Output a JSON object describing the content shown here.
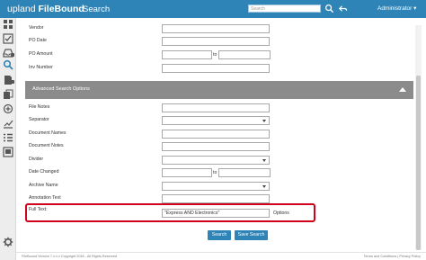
{
  "header": {
    "brand_prefix": "upland",
    "brand_name": "FileBound",
    "page_title": "Search",
    "search_placeholder": "Search",
    "user_label": "Administrator",
    "accent_color": "#2e84b6"
  },
  "fields_basic": [
    {
      "label": "Vendor"
    },
    {
      "label": "PO Date"
    },
    {
      "label": "PO Amount"
    },
    {
      "label": "Inv Number"
    }
  ],
  "range_to": "to",
  "advanced": {
    "title": "Advanced Search Options",
    "fields": [
      {
        "label": "File Notes"
      },
      {
        "label": "Separator"
      },
      {
        "label": "Document Names"
      },
      {
        "label": "Document Notes"
      },
      {
        "label": "Divider"
      },
      {
        "label": "Date Changed"
      },
      {
        "label": "Archive Name"
      },
      {
        "label": "Annotation Text"
      }
    ]
  },
  "fulltext": {
    "label": "Full Text:",
    "value": "\"Express AND Electronics\"",
    "options_label": "Options",
    "highlight_color": "#d0021b"
  },
  "buttons": {
    "search": "Search",
    "save_search": "Save Search"
  },
  "footer": {
    "left": "FileBound Version 7.x.x.x Copyright 2016 - All Rights Reserved",
    "right": "Terms and Conditions | Privacy Policy"
  },
  "sidebar_icons": [
    "grid-icon",
    "checklist-icon",
    "tray-icon",
    "search-icon",
    "document-icon",
    "documents-icon",
    "plus-circle-icon",
    "chart-icon",
    "list-icon",
    "stamp-icon",
    "gear-icon"
  ]
}
